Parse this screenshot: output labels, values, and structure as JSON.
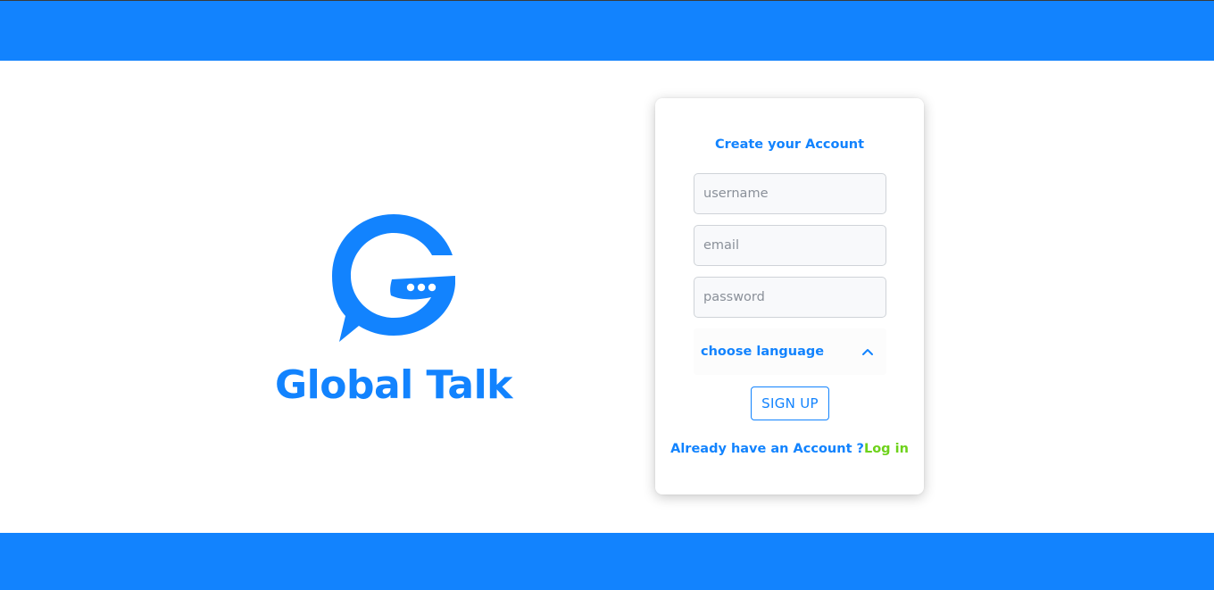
{
  "colors": {
    "brand_blue": "#1283fe",
    "link_green": "#6ed21b",
    "white": "#ffffff"
  },
  "brand": {
    "name": "Global Talk",
    "logo_icon": "chat-bubble-g-logo"
  },
  "signup_form": {
    "title": "Create your Account",
    "username_placeholder": "username",
    "email_placeholder": "email",
    "password_placeholder": "password",
    "language_label": "choose language",
    "language_icon": "chevron-up-icon",
    "submit_label": "SIGN UP",
    "login_prompt": "Already have an Account ?",
    "login_link": "Log in"
  }
}
